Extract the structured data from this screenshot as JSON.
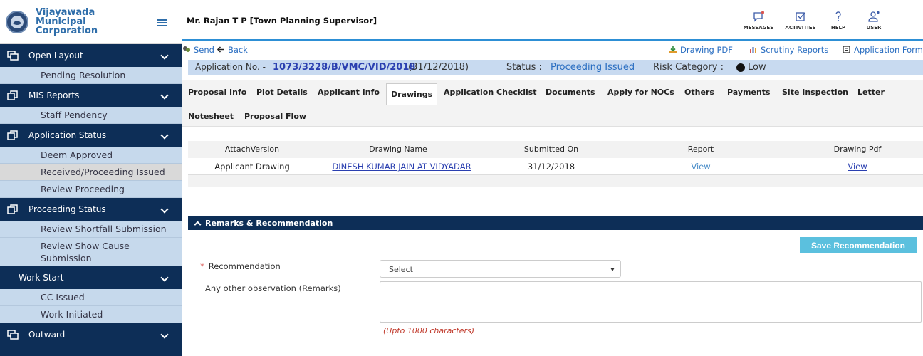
{
  "brand": {
    "name": "Vijayawada Municipal Corporation"
  },
  "sidebar": {
    "items": [
      {
        "label": "Open Layout",
        "type": "head"
      },
      {
        "label": "Pending Resolution",
        "type": "sub"
      },
      {
        "label": "MIS Reports",
        "type": "head"
      },
      {
        "label": "Staff Pendency",
        "type": "sub"
      },
      {
        "label": "Application Status",
        "type": "head"
      },
      {
        "label": "Deem Approved",
        "type": "sub"
      },
      {
        "label": "Received/Proceeding Issued",
        "type": "sub",
        "active": true
      },
      {
        "label": "Review Proceeding",
        "type": "sub"
      },
      {
        "label": "Proceeding Status",
        "type": "head"
      },
      {
        "label": "Review Shortfall Submission",
        "type": "sub"
      },
      {
        "label": "Review Show Cause Submission",
        "type": "sub"
      },
      {
        "label": "Work Start",
        "type": "head"
      },
      {
        "label": "CC Issued",
        "type": "sub"
      },
      {
        "label": "Work Initiated",
        "type": "sub"
      },
      {
        "label": "Outward",
        "type": "head"
      }
    ]
  },
  "topbar": {
    "user": "Mr. Rajan T P [Town Planning Supervisor]",
    "messages": "MESSAGES",
    "activities": "ACTIVITIES",
    "help": "HELP",
    "user_btn": "USER"
  },
  "actions": {
    "send": "Send",
    "back": "Back",
    "drawing_pdf": "Drawing PDF",
    "scrutiny": "Scrutiny Reports",
    "app_form": "Application Form"
  },
  "application": {
    "label": "Application No. -",
    "number": "1073/3228/B/VMC/VID/2018",
    "date": "(31/12/2018)",
    "status_label": "Status :",
    "status": "Proceeding Issued",
    "risk_label": "Risk Category :",
    "risk": "Low"
  },
  "tabs": [
    "Proposal Info",
    "Plot Details",
    "Applicant Info",
    "Drawings",
    "Application Checklist",
    "Documents",
    "Apply for NOCs",
    "Others",
    "Payments",
    "Site Inspection",
    "Letter",
    "Notesheet",
    "Proposal Flow"
  ],
  "drawings_table": {
    "headers": [
      "AttachVersion",
      "Drawing Name",
      "Submitted On",
      "Report",
      "Drawing Pdf"
    ],
    "rows": [
      [
        "Applicant Drawing",
        "DINESH KUMAR JAIN AT VIDYADAR",
        "31/12/2018",
        "View",
        "View"
      ]
    ]
  },
  "remarks": {
    "title": "Remarks & Recommendation",
    "save": "Save Recommendation",
    "rec_label": "Recommendation",
    "rec_required": "*",
    "rec_value": "Select",
    "obs_label": "Any other observation (Remarks)",
    "hint": "(Upto 1000 characters)"
  },
  "colors": {
    "nav": "#0d2e57",
    "sub": "#c6d9ec",
    "accent": "#2d8fd5",
    "status": "#2a6ec1",
    "save": "#5bc0de"
  }
}
